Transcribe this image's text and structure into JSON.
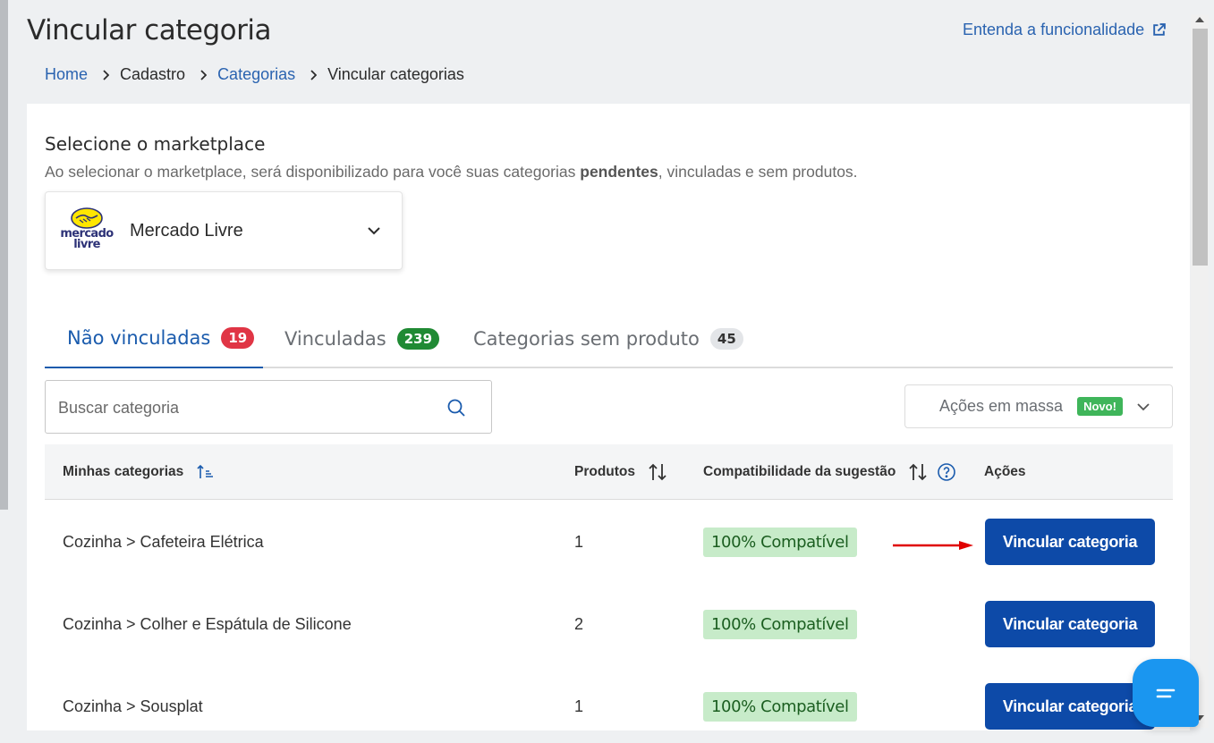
{
  "page": {
    "title": "Vincular categoria",
    "help_link": "Entenda a funcionalidade"
  },
  "breadcrumb": {
    "home": "Home",
    "cadastro": "Cadastro",
    "categorias": "Categorias",
    "current": "Vincular categorias"
  },
  "marketplace": {
    "title": "Selecione o marketplace",
    "description_pre": "Ao selecionar o marketplace, será disponibilizado para você suas categorias ",
    "description_bold": "pendentes",
    "description_post": ", vinculadas e sem produtos.",
    "logo_line1": "mercado",
    "logo_line2": "livre",
    "selected": "Mercado Livre"
  },
  "tabs": [
    {
      "label": "Não vinculadas",
      "count": "19",
      "badge_color": "#e03545",
      "active": true
    },
    {
      "label": "Vinculadas",
      "count": "239",
      "badge_color": "#208a34",
      "active": false
    },
    {
      "label": "Categorias sem produto",
      "count": "45",
      "badge_color": "#e3e5e8",
      "active": false
    }
  ],
  "search": {
    "placeholder": "Buscar categoria",
    "value": ""
  },
  "bulk_actions": {
    "label": "Ações em massa",
    "new_badge": "Novo!"
  },
  "table": {
    "headers": {
      "category": "Minhas categorias",
      "products": "Produtos",
      "compat": "Compatibilidade da sugestão",
      "actions": "Ações"
    },
    "rows": [
      {
        "category": "Cozinha > Cafeteira Elétrica",
        "products": "1",
        "compat": "100% Compatível",
        "action": "Vincular categoria"
      },
      {
        "category": "Cozinha > Colher e Espátula de Silicone",
        "products": "2",
        "compat": "100% Compatível",
        "action": "Vincular categoria"
      },
      {
        "category": "Cozinha > Sousplat",
        "products": "1",
        "compat": "100% Compatível",
        "action": "Vincular categoria"
      }
    ]
  },
  "colors": {
    "primary": "#0d4aa8",
    "link": "#2a63b0",
    "compat_bg": "#c7ebc9",
    "arrow": "#e00000",
    "chat": "#1a96f0"
  }
}
